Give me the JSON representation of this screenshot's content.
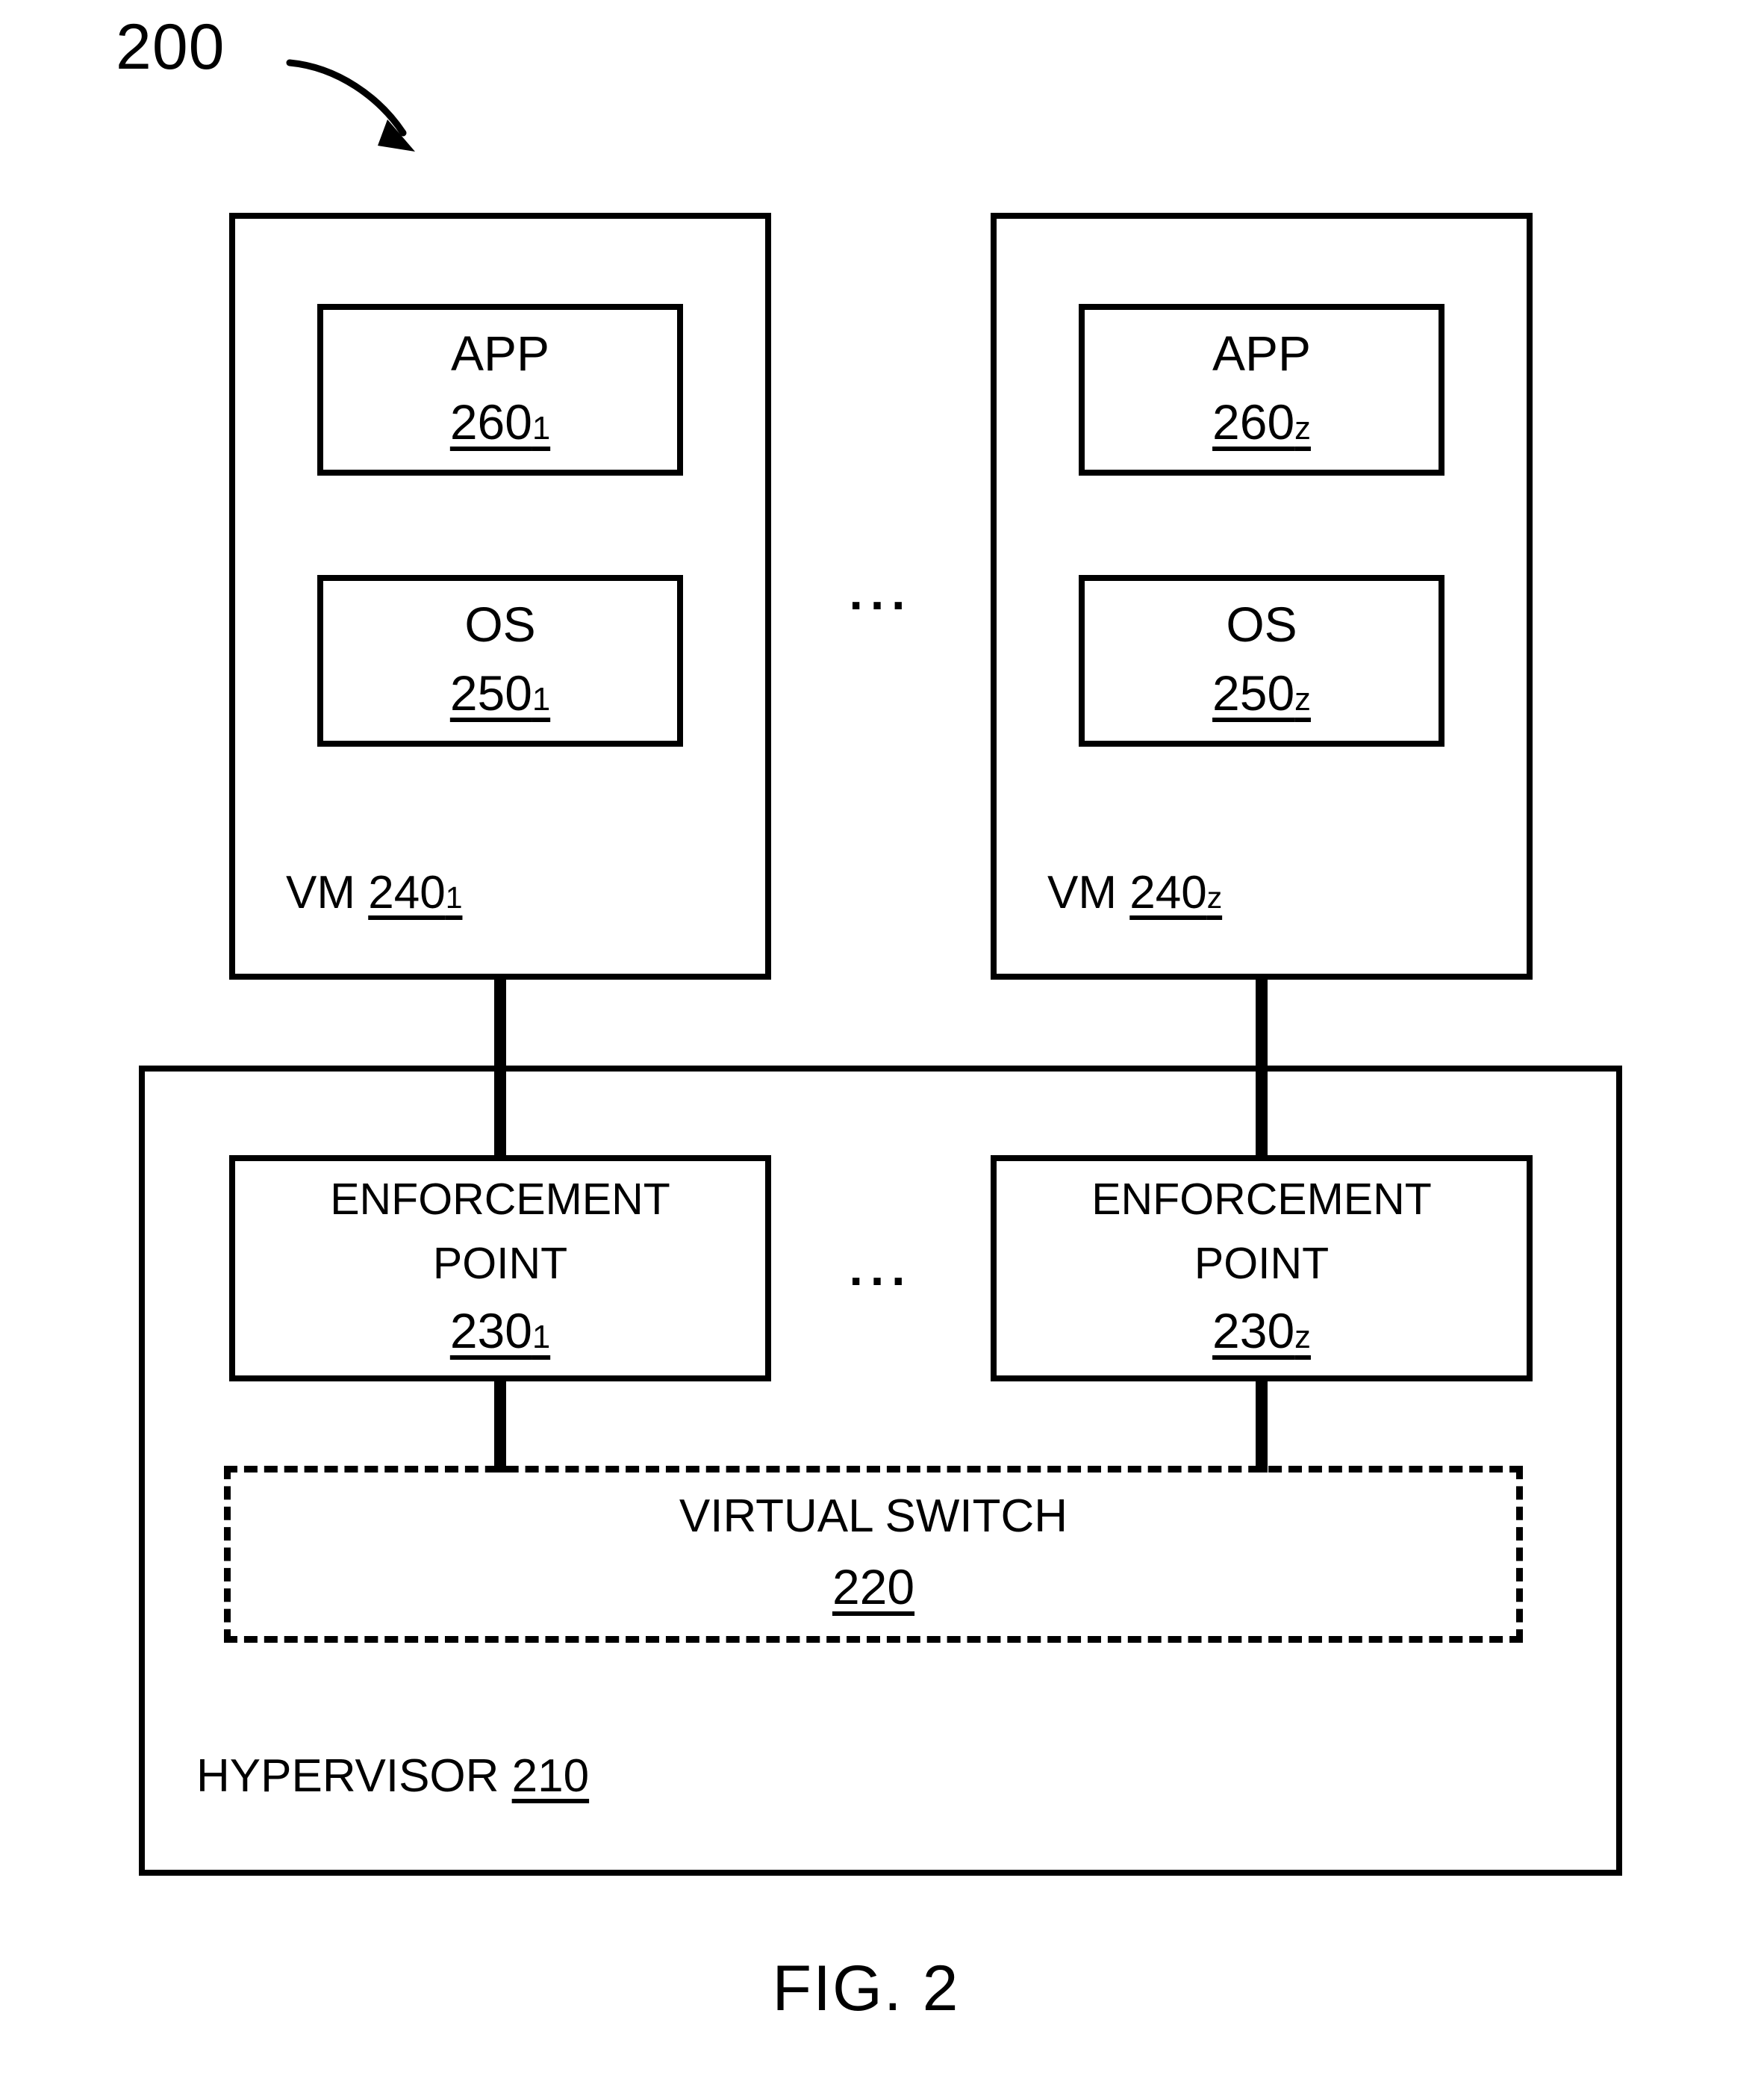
{
  "figure": {
    "caption": "FIG. 2",
    "reference_numeral": "200"
  },
  "vms": [
    {
      "id": "vm-1",
      "label_prefix": "VM ",
      "label_numeral": "240",
      "label_subscript": "1",
      "app": {
        "title": "APP",
        "numeral": "260",
        "subscript": "1"
      },
      "os": {
        "title": "OS",
        "numeral": "250",
        "subscript": "1"
      }
    },
    {
      "id": "vm-z",
      "label_prefix": "VM ",
      "label_numeral": "240",
      "label_subscript": "z",
      "app": {
        "title": "APP",
        "numeral": "260",
        "subscript": "z"
      },
      "os": {
        "title": "OS",
        "numeral": "250",
        "subscript": "z"
      }
    }
  ],
  "ellipsis": {
    "vm_row": "...",
    "enforcement_row": "..."
  },
  "hypervisor": {
    "label_prefix": "HYPERVISOR ",
    "label_numeral": "210"
  },
  "enforcement_points": [
    {
      "id": "enforcement-point-1",
      "line1": "ENFORCEMENT",
      "line2": "POINT",
      "numeral": "230",
      "subscript": "1"
    },
    {
      "id": "enforcement-point-z",
      "line1": "ENFORCEMENT",
      "line2": "POINT",
      "numeral": "230",
      "subscript": "z"
    }
  ],
  "virtual_switch": {
    "title": "VIRTUAL SWITCH",
    "numeral": "220"
  },
  "colors": {
    "stroke": "#000000",
    "background": "#ffffff"
  }
}
